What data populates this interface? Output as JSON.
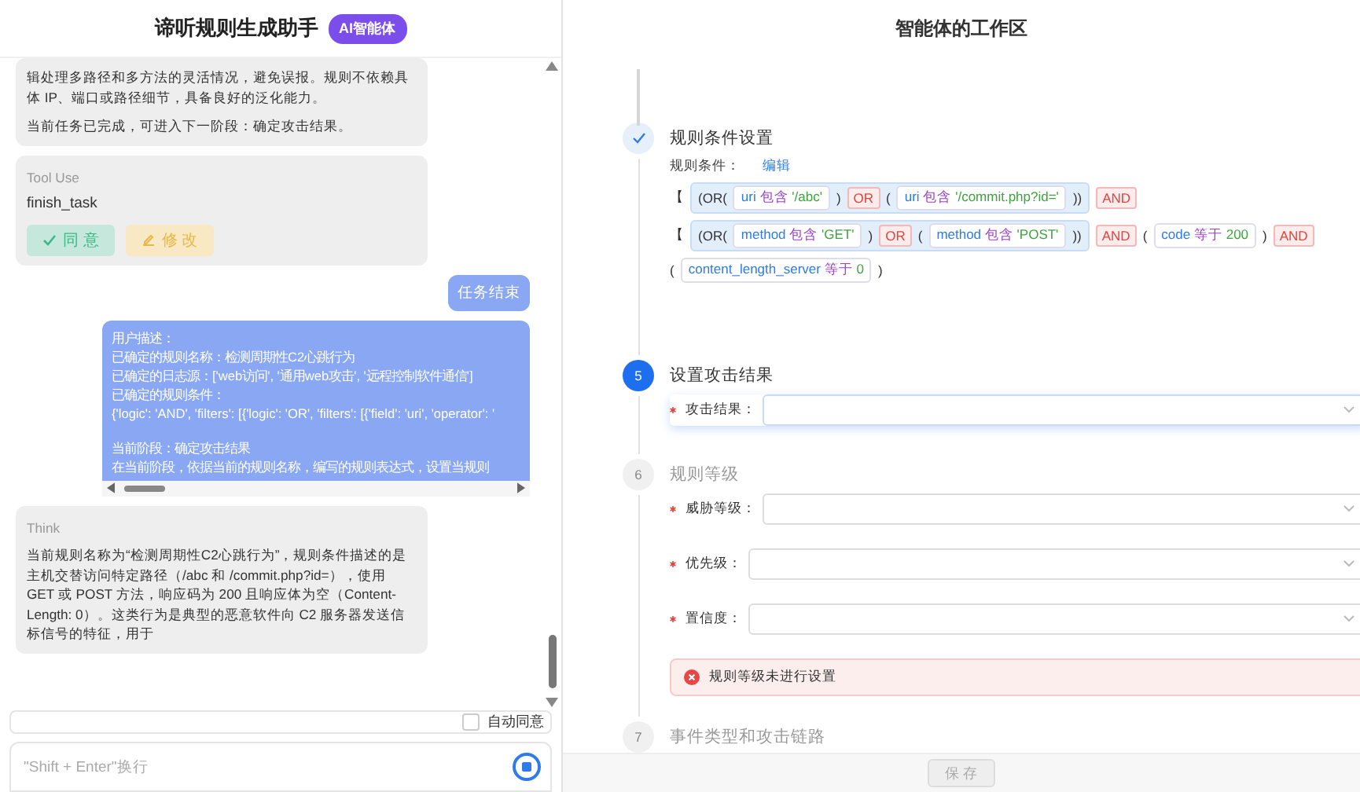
{
  "chat": {
    "title": "谛听规则生成助手",
    "badge": "AI智能体",
    "messages": [
      {
        "kind": "assistant",
        "paragraphs": [
          "辑处理多路径和多方法的灵活情况，避免误报。规则不依赖具体 IP、端口或路径细节，具备良好的泛化能力。",
          "当前任务已完成，可进入下一阶段：确定攻击结果。"
        ]
      },
      {
        "kind": "tool",
        "title": "Tool Use",
        "name": "finish_task",
        "buttons": [
          {
            "kind": "agree",
            "label": "同 意"
          },
          {
            "kind": "edit",
            "label": "修 改"
          }
        ]
      },
      {
        "kind": "user",
        "text": "任务结束"
      },
      {
        "kind": "user_block",
        "lines": [
          "用户描述：",
          "已确定的规则名称：检测周期性C2心跳行为",
          "已确定的日志源：['web访问', '通用web攻击', '远程控制软件通信']",
          "已确定的规则条件：",
          "{'logic': 'AND', 'filters': [{'logic': 'OR', 'filters': [{'field': 'uri', 'operator': '"
        ],
        "stage_lines": [
          "当前阶段：确定攻击结果",
          "在当前阶段，依据当前的规则名称，编写的规则表达式，设置当规则"
        ]
      },
      {
        "kind": "think",
        "title": "Think",
        "text": "当前规则名称为“检测周期性C2心跳行为”，规则条件描述的是主机交替访问特定路径（/abc 和 /commit.php?id=），使用 GET 或 POST 方法，响应码为 200 且响应体为空（Content-Length: 0）。这类行为是典型的恶意软件向 C2 服务器发送信标信号的特征，用于"
      }
    ],
    "auto_agree": {
      "label": "自动同意",
      "checked": false
    },
    "input": {
      "placeholder": "\"Shift + Enter\"换行"
    }
  },
  "workspace": {
    "title": "智能体的工作区",
    "steps": [
      {
        "completed": true,
        "current": false,
        "title": "规则条件设置",
        "conditions_label": "规则条件：",
        "edit_link": "编辑",
        "condition_rows": [
          [
            {
              "kind": "punct",
              "text": "【"
            },
            {
              "kind": "group",
              "items": [
                {
                  "kind": "punct",
                  "text": "(OR("
                },
                {
                  "kind": "cond",
                  "field": "uri",
                  "op": "包含",
                  "value": "'/abc'"
                },
                {
                  "kind": "punct",
                  "text": ")"
                },
                {
                  "kind": "logic",
                  "text": "OR"
                },
                {
                  "kind": "punct",
                  "text": "("
                },
                {
                  "kind": "cond",
                  "field": "uri",
                  "op": "包含",
                  "value": "'/commit.php?id='"
                },
                {
                  "kind": "punct",
                  "text": "))"
                }
              ]
            },
            {
              "kind": "logic",
              "text": "AND"
            }
          ],
          [
            {
              "kind": "punct",
              "text": "【"
            },
            {
              "kind": "group",
              "items": [
                {
                  "kind": "punct",
                  "text": "(OR("
                },
                {
                  "kind": "cond",
                  "field": "method",
                  "op": "包含",
                  "value": "'GET'"
                },
                {
                  "kind": "punct",
                  "text": ")"
                },
                {
                  "kind": "logic",
                  "text": "OR"
                },
                {
                  "kind": "punct",
                  "text": "("
                },
                {
                  "kind": "cond",
                  "field": "method",
                  "op": "包含",
                  "value": "'POST'"
                },
                {
                  "kind": "punct",
                  "text": "))"
                }
              ]
            },
            {
              "kind": "logic",
              "text": "AND"
            },
            {
              "kind": "punct",
              "text": "("
            },
            {
              "kind": "cond",
              "field": "code",
              "op": "等于",
              "value": "200"
            },
            {
              "kind": "punct",
              "text": ")"
            },
            {
              "kind": "logic",
              "text": "AND"
            }
          ],
          [
            {
              "kind": "punct",
              "text": "("
            },
            {
              "kind": "cond",
              "field": "content_length_server",
              "op": "等于",
              "value": "0"
            },
            {
              "kind": "punct",
              "text": ")"
            }
          ]
        ]
      },
      {
        "completed": false,
        "current": true,
        "marker": "5",
        "title": "设置攻击结果",
        "fields": [
          {
            "label": "攻击结果：",
            "required": true,
            "focused": true
          }
        ]
      },
      {
        "completed": false,
        "current": false,
        "marker": "6",
        "title": "规则等级",
        "fields": [
          {
            "label": "威胁等级：",
            "required": true,
            "focused": false
          },
          {
            "label": "优先级：",
            "required": true,
            "focused": false
          },
          {
            "label": "置信度：",
            "required": true,
            "focused": false
          }
        ],
        "alert": {
          "kind": "error",
          "text": "规则等级未进行设置"
        }
      },
      {
        "completed": false,
        "current": false,
        "marker": "7",
        "title": "事件类型和攻击链路"
      }
    ],
    "save_button": {
      "label": "保 存",
      "disabled": true
    }
  }
}
